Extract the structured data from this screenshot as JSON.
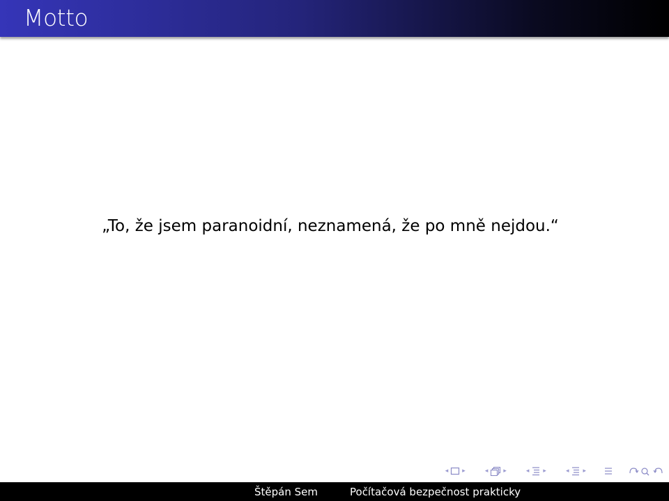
{
  "slide": {
    "title": "Motto",
    "quote": "„To, že jsem paranoidní, neznamená, že po mně nejdou.“"
  },
  "footer": {
    "author": "Štěpán Sem",
    "presentation_title": "Počítačová bezpečnost prakticky"
  },
  "navigation": {
    "icons": [
      "slide-nav-icon",
      "frame-nav-icon",
      "subsection-nav-icon",
      "section-nav-icon",
      "outline-icon",
      "search-zoom-icon"
    ]
  },
  "colors": {
    "header_start": "#3535b8",
    "header_end": "#000000",
    "footer_bg": "#000000",
    "nav_icon": "#8a8ac6"
  }
}
